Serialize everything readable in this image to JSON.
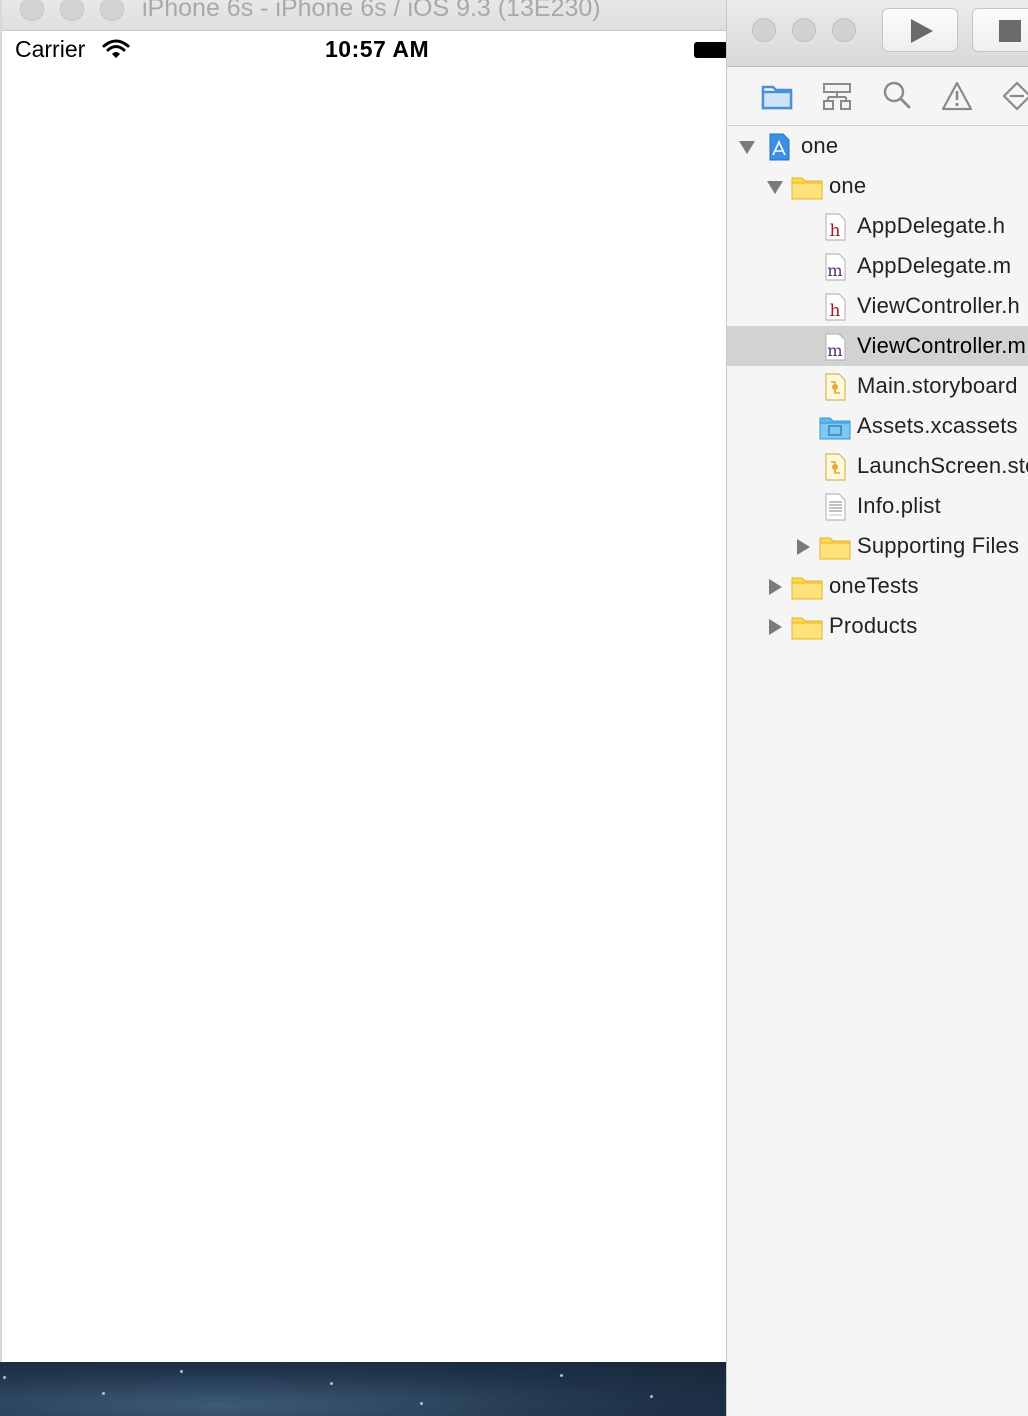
{
  "simulator": {
    "window_title": "iPhone 6s - iPhone 6s / iOS 9.3 (13E230)",
    "status_bar": {
      "carrier": "Carrier",
      "time": "10:57 AM"
    }
  },
  "xcode": {
    "navigator_tabs": [
      {
        "name": "project-navigator",
        "icon": "folder-icon",
        "active": true
      },
      {
        "name": "symbol-navigator",
        "icon": "hierarchy-icon",
        "active": false
      },
      {
        "name": "find-navigator",
        "icon": "search-icon",
        "active": false
      },
      {
        "name": "issue-navigator",
        "icon": "warning-icon",
        "active": false
      },
      {
        "name": "test-navigator",
        "icon": "diamond-icon",
        "active": false
      }
    ],
    "file_tree": [
      {
        "label": "one",
        "type": "project",
        "expanded": true,
        "depth": 0
      },
      {
        "label": "one",
        "type": "folder",
        "expanded": true,
        "depth": 1
      },
      {
        "label": "AppDelegate.h",
        "type": "header",
        "depth": 2
      },
      {
        "label": "AppDelegate.m",
        "type": "source",
        "depth": 2
      },
      {
        "label": "ViewController.h",
        "type": "header",
        "depth": 2
      },
      {
        "label": "ViewController.m",
        "type": "source",
        "depth": 2,
        "selected": true
      },
      {
        "label": "Main.storyboard",
        "type": "storyboard",
        "depth": 2
      },
      {
        "label": "Assets.xcassets",
        "type": "assets",
        "depth": 2
      },
      {
        "label": "LaunchScreen.storyboard",
        "type": "storyboard",
        "depth": 2
      },
      {
        "label": "Info.plist",
        "type": "plist",
        "depth": 2
      },
      {
        "label": "Supporting Files",
        "type": "folder",
        "expanded": false,
        "depth": 2
      },
      {
        "label": "oneTests",
        "type": "folder",
        "expanded": false,
        "depth": 1
      },
      {
        "label": "Products",
        "type": "folder",
        "expanded": false,
        "depth": 1
      }
    ]
  },
  "colors": {
    "selection": "#d2d2d2",
    "folder": "#ffd84d",
    "header_letter": "#a0182a",
    "source_letter": "#5a2a7a",
    "accent_blue": "#4a90d9"
  }
}
